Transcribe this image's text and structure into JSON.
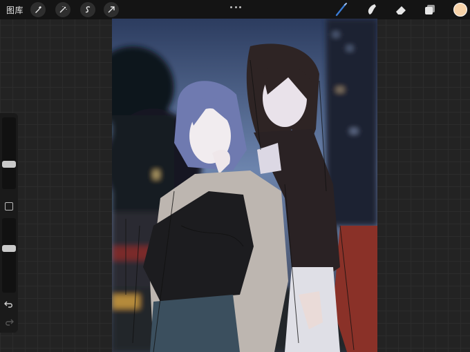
{
  "toolbar": {
    "gallery_label": "图库",
    "left_tools": [
      "actions-wrench-icon",
      "adjustments-wand-icon",
      "selection-s-icon",
      "transform-arrow-icon"
    ],
    "right_tools": [
      "brush-icon",
      "smudge-icon",
      "eraser-icon",
      "layers-icon"
    ],
    "active_tool": "brush-icon",
    "current_color": "#f6d2a8",
    "accent_color": "#3a7bd5"
  },
  "sidebar": {
    "brush_size_level": 0.33,
    "opacity_level": 0.6,
    "buttons": [
      "modify-square-icon",
      "undo-icon",
      "redo-icon"
    ]
  },
  "canvas": {
    "content": "illustration"
  }
}
